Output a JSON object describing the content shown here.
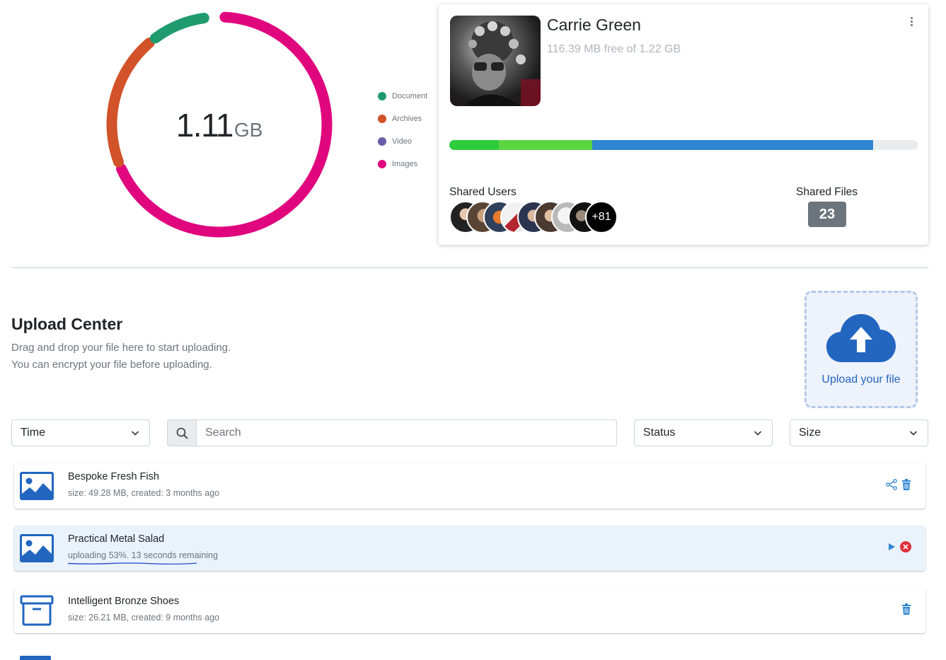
{
  "storage": {
    "total_value": "1.11",
    "total_unit": "GB",
    "legend": [
      {
        "label": "Document",
        "color": "#1f9b6f"
      },
      {
        "label": "Archives",
        "color": "#d2522a"
      },
      {
        "label": "Video",
        "color": "#6b5ba8"
      },
      {
        "label": "Images",
        "color": "#e0067e"
      }
    ],
    "donut_shares": {
      "Document": 0.09,
      "Archives": 0.205,
      "Video": 0.0,
      "Images": 0.685
    }
  },
  "profile": {
    "name": "Carrie Green",
    "quota_text": "116.39 MB free of 1.22 GB",
    "menu_icon": "kebab-icon",
    "usage_bar": [
      {
        "name": "segment-1",
        "fraction": 0.105,
        "color": "#2dcc3a"
      },
      {
        "name": "segment-2",
        "fraction": 0.2,
        "color": "#5bd540"
      },
      {
        "name": "segment-3",
        "fraction": 0.6,
        "color": "#2f86d2"
      }
    ],
    "shared_users_label": "Shared Users",
    "shared_users_more": "+81",
    "shared_files_label": "Shared Files",
    "shared_files_count": "23"
  },
  "upload_center": {
    "title": "Upload Center",
    "desc_line1": "Drag and drop your file here to start uploading.",
    "desc_line2": "You can encrypt your file before uploading.",
    "upload_label": "Upload your file",
    "upload_icon": "cloud-upload-icon"
  },
  "filters": {
    "time": "Time",
    "search_placeholder": "Search",
    "status": "Status",
    "size": "Size"
  },
  "files": [
    {
      "name": "Bespoke Fresh Fish",
      "meta": "size: 49.28 MB, created: 3 months ago",
      "icon": "image-file-icon",
      "actions": [
        "share",
        "delete"
      ]
    },
    {
      "name": "Practical Metal Salad",
      "meta": "uploading 53%. 13 seconds remaining",
      "icon": "image-file-icon",
      "progress": 0.53,
      "actions": [
        "play",
        "cancel"
      ]
    },
    {
      "name": "Intelligent Bronze Shoes",
      "meta": "size: 26.21 MB, created: 9 months ago",
      "icon": "archive-file-icon",
      "actions": [
        "delete"
      ]
    }
  ]
}
